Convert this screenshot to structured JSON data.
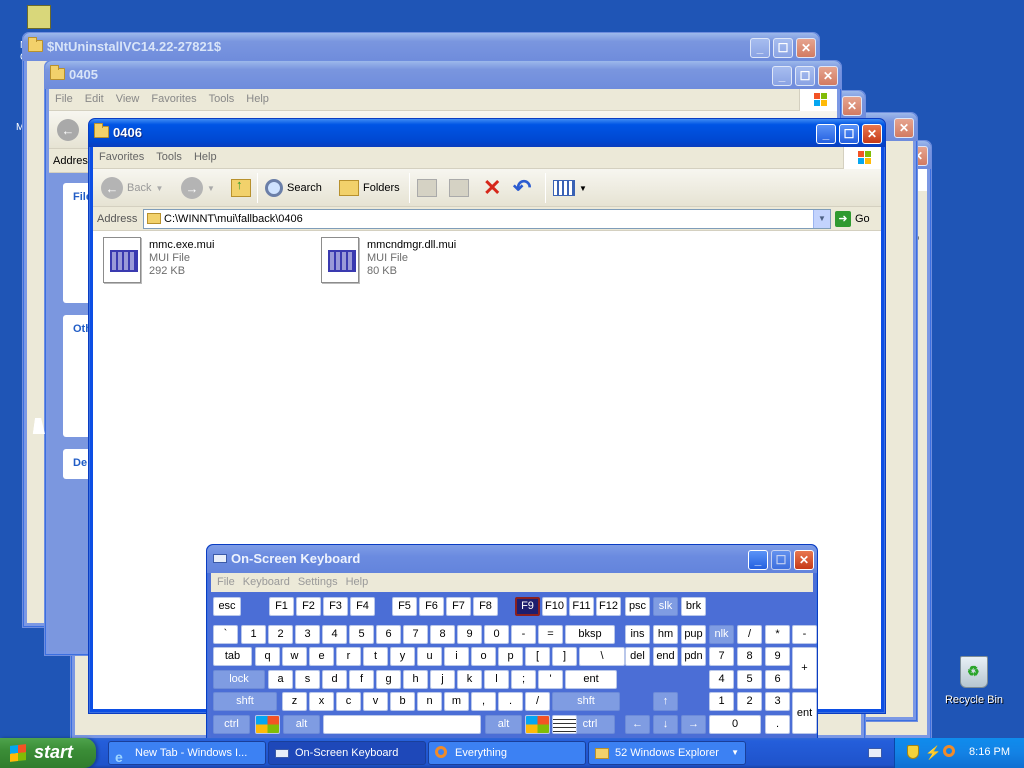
{
  "desktop": {
    "recycle_bin_label": "Recycle Bin",
    "left_partial_labels": [
      "M",
      "C",
      "M"
    ]
  },
  "windows": {
    "uninstall": {
      "title": "$NtUninstallVC14.22-27821$"
    },
    "w0405": {
      "title": "0405",
      "menu": [
        "File",
        "Edit",
        "View",
        "Favorites",
        "Tools",
        "Help"
      ],
      "address_label": "Address",
      "sidebar_partial": [
        "File",
        "Oth",
        "De"
      ]
    },
    "w0406": {
      "title": "0406",
      "menu": [
        "Favorites",
        "Tools",
        "Help"
      ],
      "toolbar": {
        "back": "Back",
        "search": "Search",
        "folders": "Folders"
      },
      "address_label": "Address",
      "address_value": "C:\\WINNT\\mui\\fallback\\0406",
      "go_label": "Go",
      "files": [
        {
          "name": "mmc.exe.mui",
          "type": "MUI File",
          "size": "292 KB"
        },
        {
          "name": "mmcndmgr.dll.mui",
          "type": "MUI File",
          "size": "80 KB"
        }
      ]
    },
    "back_go_label": "Go"
  },
  "osk": {
    "title": "On-Screen Keyboard",
    "menu": [
      "File",
      "Keyboard",
      "Settings",
      "Help"
    ],
    "rows": {
      "fn": [
        "esc",
        "F1",
        "F2",
        "F3",
        "F4",
        "F5",
        "F6",
        "F7",
        "F8",
        "F9",
        "F10",
        "F11",
        "F12",
        "psc",
        "slk",
        "brk"
      ],
      "num": [
        "`",
        "1",
        "2",
        "3",
        "4",
        "5",
        "6",
        "7",
        "8",
        "9",
        "0",
        "-",
        "=",
        "bksp",
        "ins",
        "hm",
        "pup",
        "nlk",
        "/",
        "*",
        "-"
      ],
      "top": [
        "tab",
        "q",
        "w",
        "e",
        "r",
        "t",
        "y",
        "u",
        "i",
        "o",
        "p",
        "[",
        "]",
        "\\",
        "del",
        "end",
        "pdn",
        "7",
        "8",
        "9",
        "+"
      ],
      "home": [
        "lock",
        "a",
        "s",
        "d",
        "f",
        "g",
        "h",
        "j",
        "k",
        "l",
        ";",
        "'",
        "ent",
        "4",
        "5",
        "6"
      ],
      "shift": [
        "shft",
        "z",
        "x",
        "c",
        "v",
        "b",
        "n",
        "m",
        ",",
        ".",
        "/",
        "shft",
        "1",
        "2",
        "3",
        "ent"
      ],
      "bottom": [
        "ctrl",
        "alt",
        "alt",
        "ctrl",
        "0",
        "."
      ]
    },
    "selected_key": "F9"
  },
  "taskbar": {
    "start_label": "start",
    "tasks": [
      {
        "label": "New Tab - Windows I..."
      },
      {
        "label": "On-Screen Keyboard"
      },
      {
        "label": "Everything"
      },
      {
        "label": "52 Windows Explorer"
      }
    ],
    "clock": "8:16 PM"
  }
}
